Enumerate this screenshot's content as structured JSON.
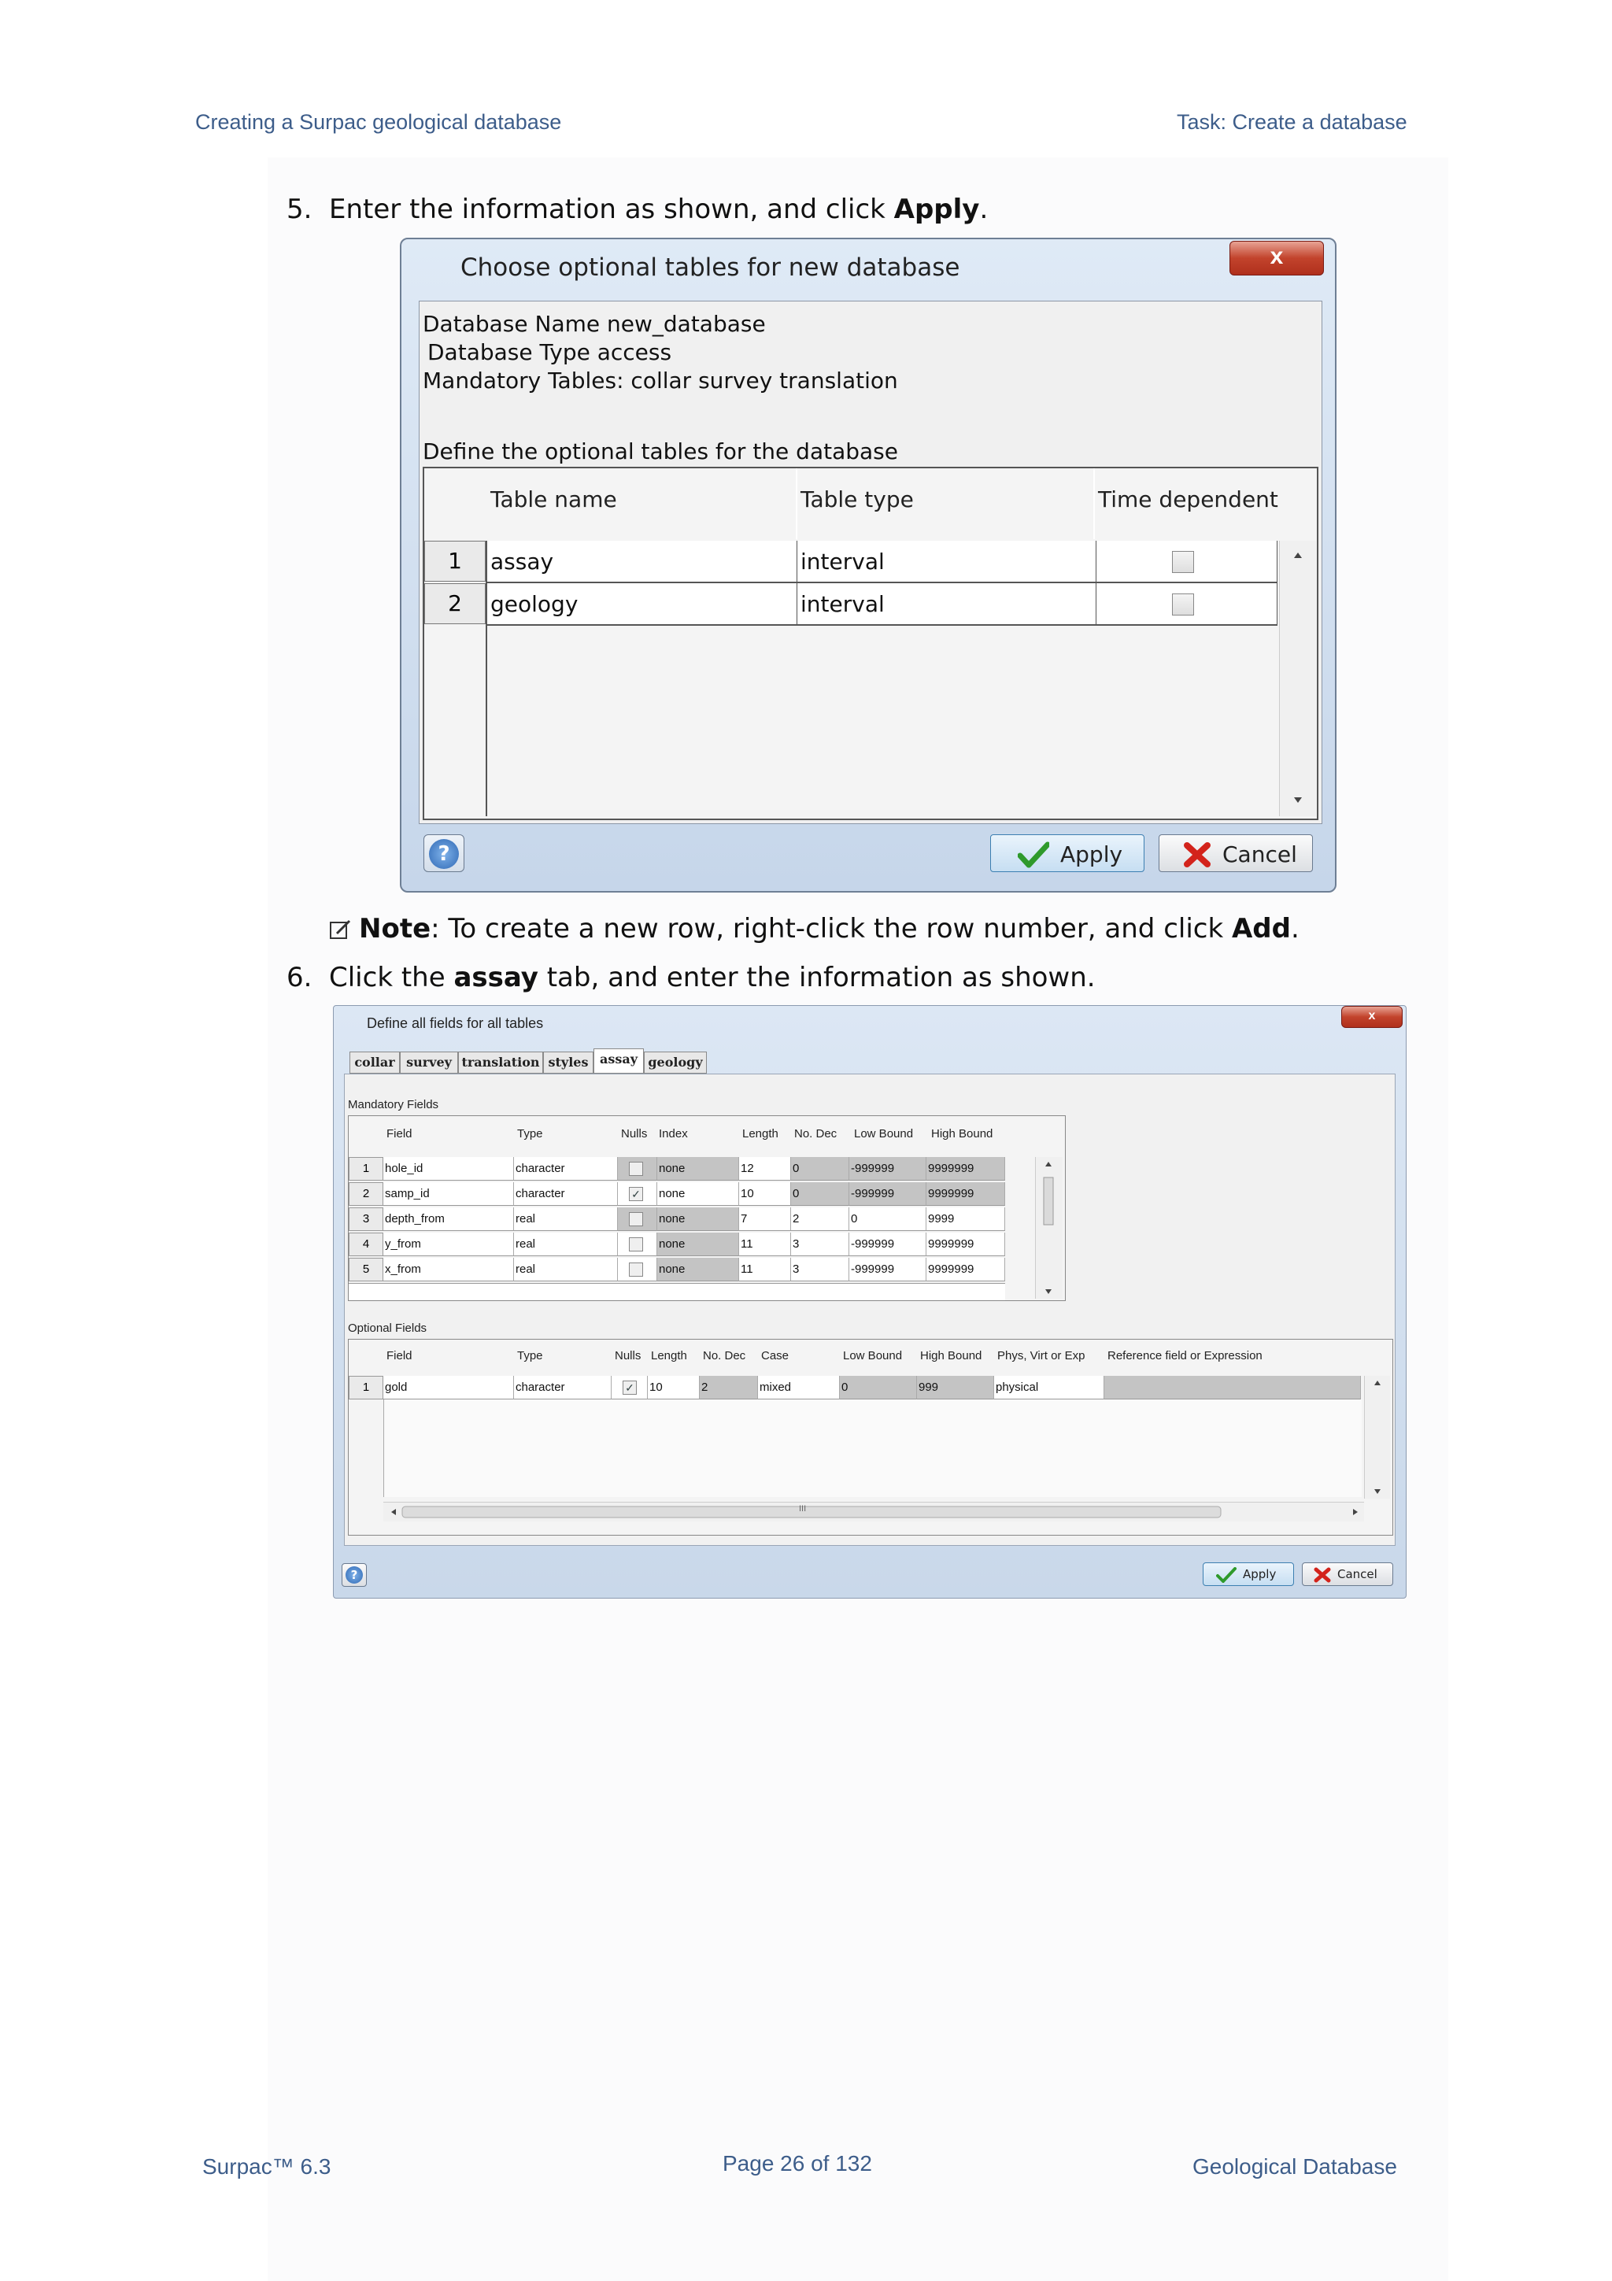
{
  "header": {
    "left": "Creating a Surpac geological database",
    "right": "Task: Create a database"
  },
  "step5": {
    "number": "5.",
    "text_pre": "Enter the information as shown, and click ",
    "text_bold": "Apply",
    "text_post": "."
  },
  "dialog1": {
    "title": "Choose optional tables for new database",
    "close": "x",
    "db_name_line": "Database Name  new_database",
    "db_type_line": "Database Type  access",
    "mandatory_line": "Mandatory Tables: collar  survey  translation",
    "define_line": "Define the optional tables for the database",
    "columns": [
      "Table name",
      "Table type",
      "Time dependent"
    ],
    "rows": [
      {
        "num": "1",
        "name": "assay",
        "type": "interval"
      },
      {
        "num": "2",
        "name": "geology",
        "type": "interval"
      }
    ],
    "help": "?",
    "apply": "Apply",
    "cancel": "Cancel"
  },
  "note": {
    "label": "Note",
    "text_pre": ": To create a new row, right-click the row number, and click ",
    "text_bold": "Add",
    "text_post": "."
  },
  "step6": {
    "number": "6.",
    "text_pre": "Click the ",
    "text_bold": "assay",
    "text_post": " tab, and enter the information as shown."
  },
  "dialog2": {
    "title": "Define all fields for all tables",
    "close": "x",
    "tabs": [
      "collar",
      "survey",
      "translation",
      "styles",
      "assay",
      "geology"
    ],
    "active_tab": "assay",
    "mandatory_label": "Mandatory Fields",
    "mandatory_columns": [
      "Field",
      "Type",
      "Nulls",
      "Index",
      "Length",
      "No. Dec",
      "Low Bound",
      "High Bound"
    ],
    "mandatory_rows": [
      {
        "num": "1",
        "field": "hole_id",
        "type": "character",
        "nulls": false,
        "index": "none",
        "length": "12",
        "dec": "0",
        "low": "-999999",
        "high": "9999999"
      },
      {
        "num": "2",
        "field": "samp_id",
        "type": "character",
        "nulls": true,
        "index": "none",
        "length": "10",
        "dec": "0",
        "low": "-999999",
        "high": "9999999"
      },
      {
        "num": "3",
        "field": "depth_from",
        "type": "real",
        "nulls": false,
        "index": "none",
        "length": "7",
        "dec": "2",
        "low": "0",
        "high": "9999"
      },
      {
        "num": "4",
        "field": "y_from",
        "type": "real",
        "nulls": false,
        "index": "none",
        "length": "11",
        "dec": "3",
        "low": "-999999",
        "high": "9999999"
      },
      {
        "num": "5",
        "field": "x_from",
        "type": "real",
        "nulls": false,
        "index": "none",
        "length": "11",
        "dec": "3",
        "low": "-999999",
        "high": "9999999"
      }
    ],
    "optional_label": "Optional Fields",
    "optional_columns": [
      "Field",
      "Type",
      "Nulls",
      "Length",
      "No. Dec",
      "Case",
      "Low Bound",
      "High Bound",
      "Phys, Virt or Exp",
      "Reference field or Expression"
    ],
    "optional_rows": [
      {
        "num": "1",
        "field": "gold",
        "type": "character",
        "nulls": true,
        "length": "10",
        "dec": "2",
        "case": "mixed",
        "low": "0",
        "high": "999",
        "pve": "physical",
        "ref": ""
      }
    ],
    "hscroll_mark": "III",
    "help": "?",
    "apply": "Apply",
    "cancel": "Cancel"
  },
  "footer": {
    "left": "Surpac™ 6.3",
    "center": "Page 26 of 132",
    "right": "Geological Database"
  }
}
